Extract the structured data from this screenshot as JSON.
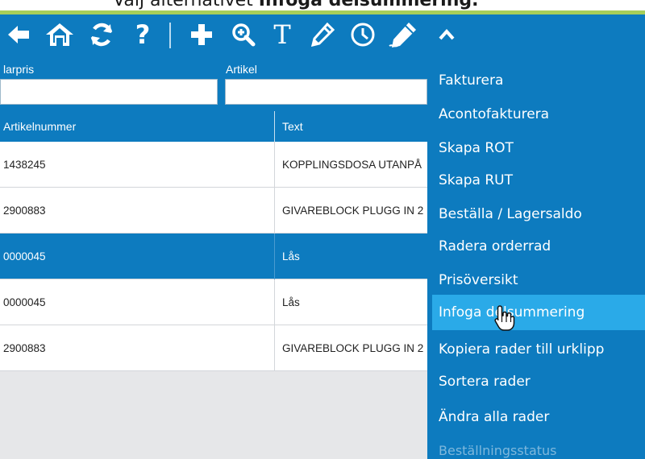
{
  "caption": {
    "prefix": "Välj alternativet ",
    "bold": "Infoga delsummering."
  },
  "toolbar": {
    "buttons": [
      {
        "icon": "arrow-left-icon"
      },
      {
        "icon": "home-icon"
      },
      {
        "icon": "refresh-icon"
      },
      {
        "icon": "help-icon",
        "label": "?"
      },
      {
        "icon": "plus-icon"
      },
      {
        "icon": "zoom-in-icon"
      },
      {
        "icon": "text-icon",
        "label": "T"
      },
      {
        "icon": "pencil-icon"
      },
      {
        "icon": "clock-icon"
      },
      {
        "icon": "signature-icon"
      },
      {
        "icon": "chevron-up-icon"
      }
    ],
    "accent": "#0d7bbf"
  },
  "filters": {
    "col1_label": "larpris",
    "col2_label": "Artikel",
    "col1_value": "",
    "col2_value": ""
  },
  "table": {
    "headers": [
      "Artikelnummer",
      "Text"
    ],
    "rows": [
      {
        "artikelnummer": "1438245",
        "text": "KOPPLINGSDOSA UTANPÅ",
        "selected": false
      },
      {
        "artikelnummer": "2900883",
        "text": "GIVAREBLOCK PLUGG IN 2",
        "selected": false
      },
      {
        "artikelnummer": "0000045",
        "text": "Lås",
        "selected": true
      },
      {
        "artikelnummer": "0000045",
        "text": "Lås",
        "selected": false
      },
      {
        "artikelnummer": "2900883",
        "text": "GIVAREBLOCK PLUGG IN 2",
        "selected": false
      }
    ]
  },
  "menu": {
    "items": [
      {
        "label": "Fakturera"
      },
      {
        "label": "Acontofakturera"
      },
      {
        "label": "Skapa ROT"
      },
      {
        "label": "Skapa RUT"
      },
      {
        "label": "Beställa / Lagersaldo"
      },
      {
        "label": "Radera orderrad"
      },
      {
        "label": "Prisöversikt"
      },
      {
        "label": "Infoga delsummering",
        "hover": true
      },
      {
        "label": "Kopiera rader till urklipp"
      },
      {
        "label": "Sortera rader"
      },
      {
        "label": "Ändra alla rader"
      },
      {
        "label": "Beställningsstatus",
        "disabled": true
      }
    ],
    "hover_color": "#2aaae8"
  }
}
